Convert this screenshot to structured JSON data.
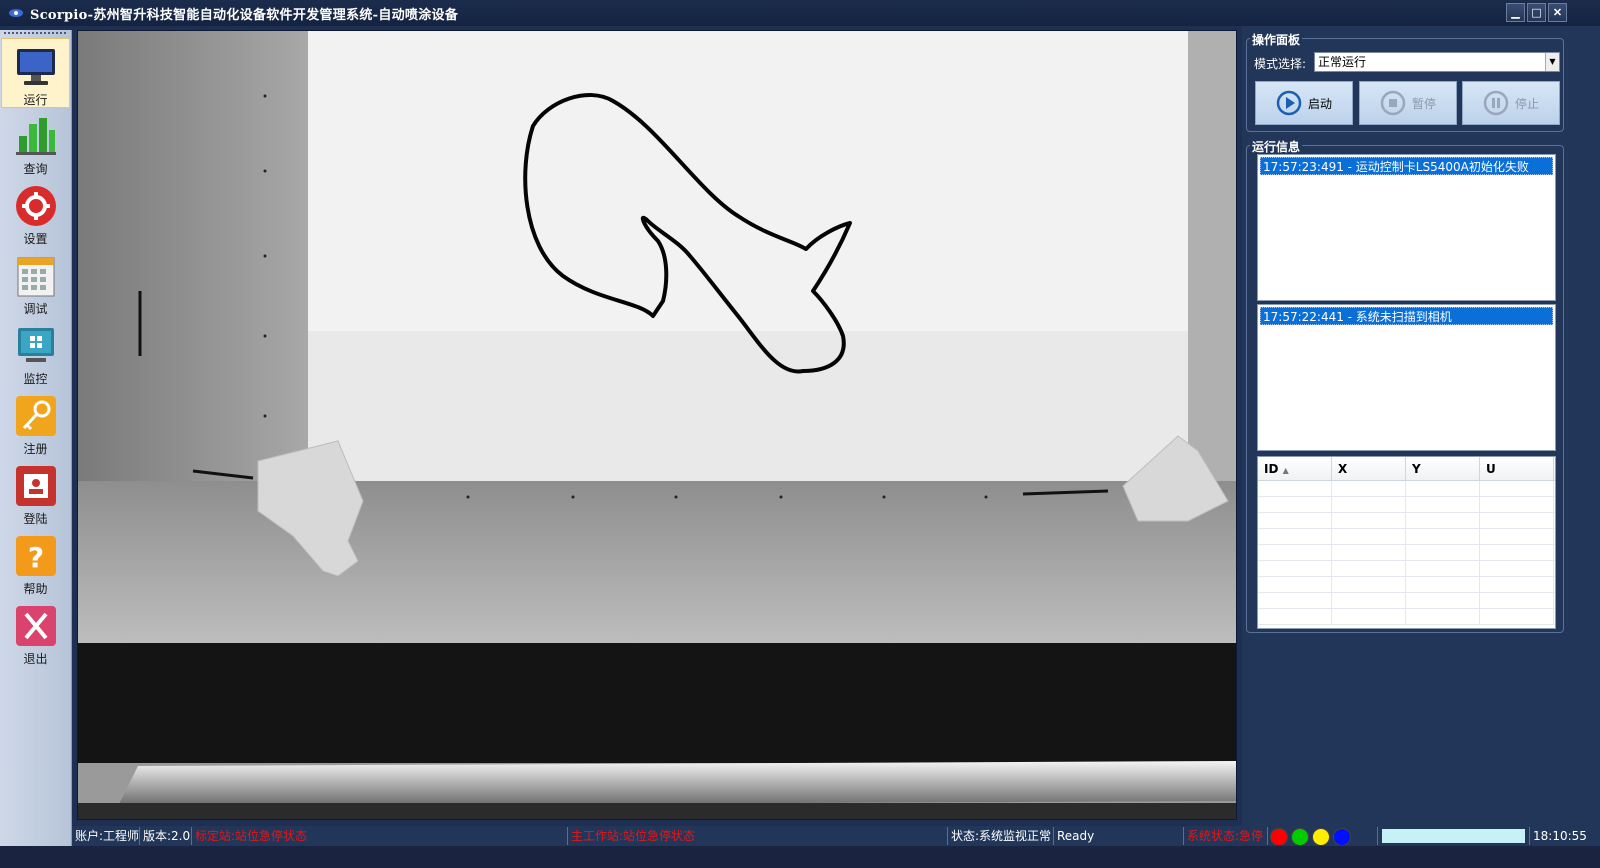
{
  "window": {
    "title": "Scorpio-苏州智升科技智能自动化设备软件开发管理系统-自动喷涂设备",
    "minimize": "▁",
    "maximize": "□",
    "close": "✕"
  },
  "sidebar": {
    "items": [
      {
        "label": "运行",
        "icon": "monitor-icon",
        "active": true
      },
      {
        "label": "查询",
        "icon": "bar-chart-icon"
      },
      {
        "label": "设置",
        "icon": "gear-icon"
      },
      {
        "label": "调试",
        "icon": "calculator-icon"
      },
      {
        "label": "监控",
        "icon": "windows-monitor-icon"
      },
      {
        "label": "注册",
        "icon": "key-icon"
      },
      {
        "label": "登陆",
        "icon": "login-card-icon"
      },
      {
        "label": "帮助",
        "icon": "help-icon"
      },
      {
        "label": "退出",
        "icon": "exit-icon"
      }
    ]
  },
  "operation_panel": {
    "title": "操作面板",
    "mode_label": "模式选择:",
    "mode_value": "正常运行",
    "buttons": {
      "start": "启动",
      "pause": "暂停",
      "stop": "停止"
    }
  },
  "run_info": {
    "title": "运行信息",
    "log1": "17:57:23:491 - 运动控制卡LS5400A初始化失败",
    "log2": "17:57:22:441 - 系统未扫描到相机"
  },
  "grid": {
    "columns": [
      "ID",
      "X",
      "Y",
      "U"
    ]
  },
  "statusbar": {
    "account": "账户:工程师",
    "version": "版本:2.0",
    "calib_station": "标定站:站位急停状态",
    "main_station": "主工作站:站位急停状态",
    "state": "状态:系统监视正常",
    "ready": "Ready",
    "system_state": "系统状态:急停",
    "time": "18:10:55"
  },
  "colors": {
    "accent_blue": "#0a6fd6",
    "status_red": "#e21818",
    "panel_bg": "#223659",
    "leds": [
      "#ff0000",
      "#00cc00",
      "#ffee00",
      "#0010ff"
    ]
  }
}
